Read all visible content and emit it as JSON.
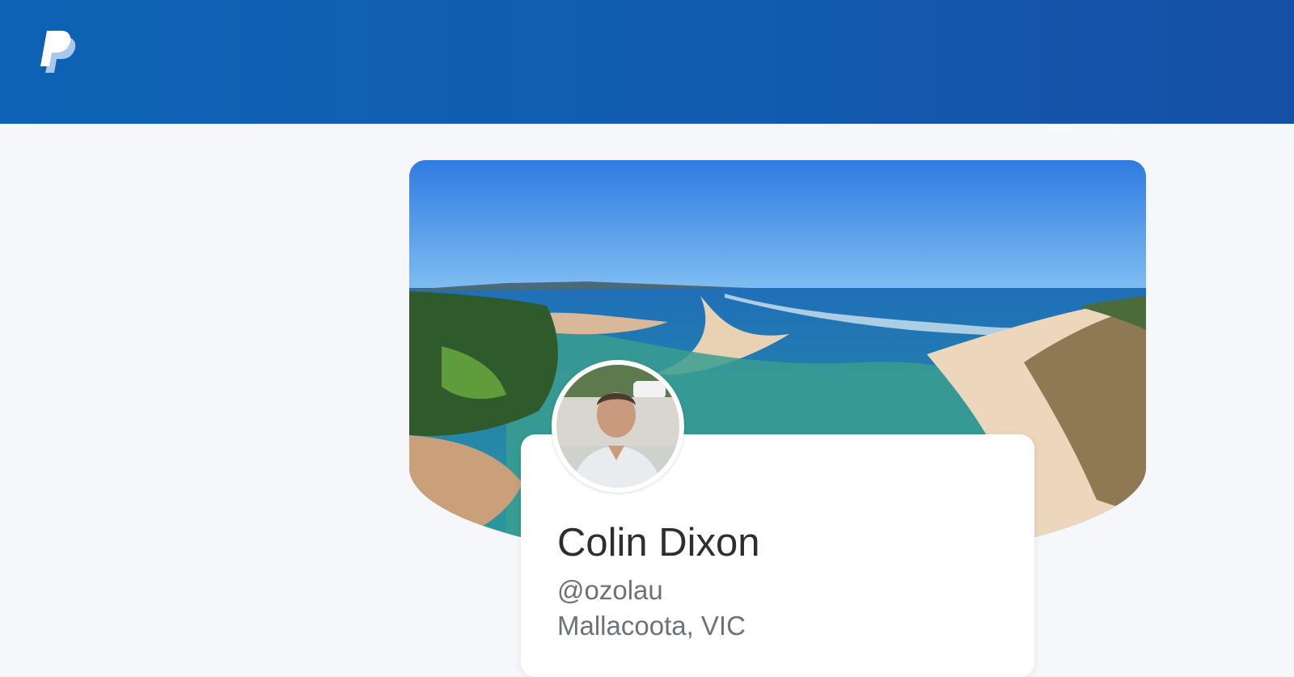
{
  "header": {
    "logo_icon": "paypal-logo-icon",
    "brand_color": "#0f5fb3"
  },
  "profile": {
    "cover_image": "beach-estuary-aerial-photo",
    "avatar_image": "profile-photo",
    "name": "Colin Dixon",
    "handle": "@ozolau",
    "location": "Mallacoota, VIC"
  }
}
